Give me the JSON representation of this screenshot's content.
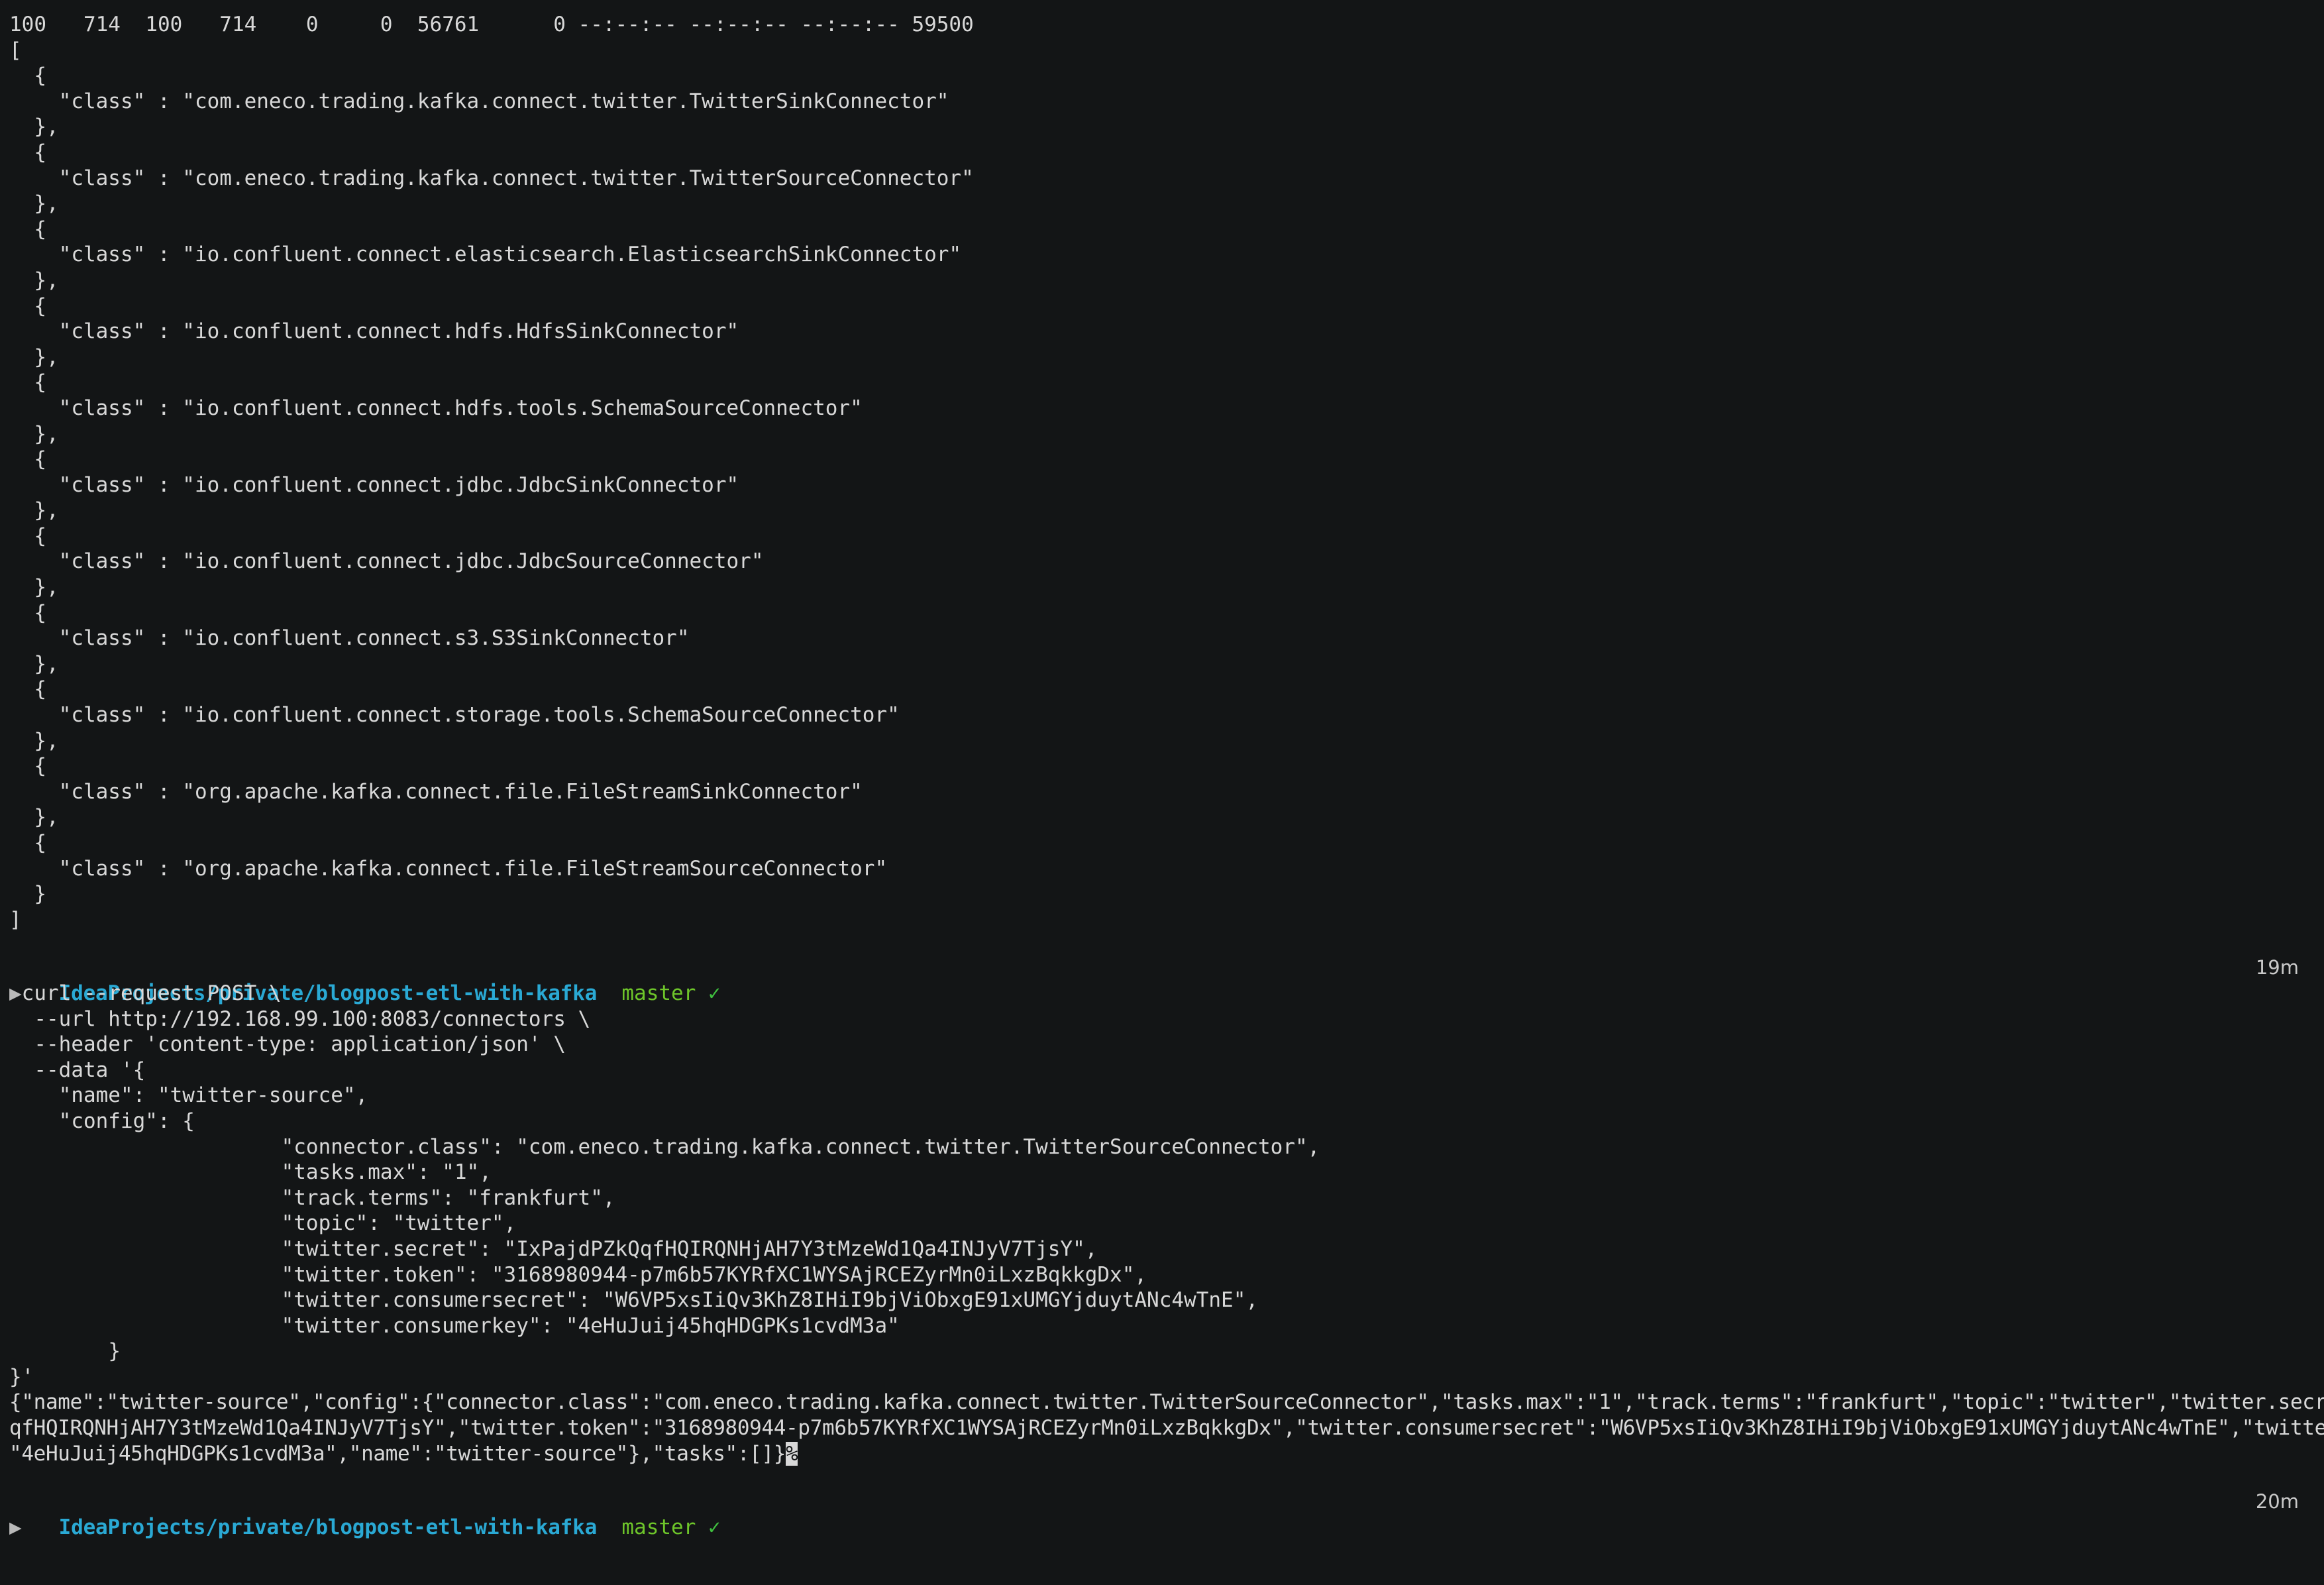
{
  "terminal": {
    "background_color": "#131516",
    "foreground_color": "#d8d8d8",
    "path_color": "#2aa9d4",
    "branch_color": "#6ec62a"
  },
  "curl_progress_line": "100   714  100   714    0     0  56761      0 --:--:-- --:--:-- --:--:-- 59500",
  "connectors_response": {
    "open_bracket": "[",
    "close_bracket": "]",
    "entries": [
      {
        "open": "{",
        "key": "\"class\"",
        "sep": " : ",
        "value": "\"com.eneco.trading.kafka.connect.twitter.TwitterSinkConnector\"",
        "close": "},"
      },
      {
        "open": "{",
        "key": "\"class\"",
        "sep": " : ",
        "value": "\"com.eneco.trading.kafka.connect.twitter.TwitterSourceConnector\"",
        "close": "},"
      },
      {
        "open": "{",
        "key": "\"class\"",
        "sep": " : ",
        "value": "\"io.confluent.connect.elasticsearch.ElasticsearchSinkConnector\"",
        "close": "},"
      },
      {
        "open": "{",
        "key": "\"class\"",
        "sep": " : ",
        "value": "\"io.confluent.connect.hdfs.HdfsSinkConnector\"",
        "close": "},"
      },
      {
        "open": "{",
        "key": "\"class\"",
        "sep": " : ",
        "value": "\"io.confluent.connect.hdfs.tools.SchemaSourceConnector\"",
        "close": "},"
      },
      {
        "open": "{",
        "key": "\"class\"",
        "sep": " : ",
        "value": "\"io.confluent.connect.jdbc.JdbcSinkConnector\"",
        "close": "},"
      },
      {
        "open": "{",
        "key": "\"class\"",
        "sep": " : ",
        "value": "\"io.confluent.connect.jdbc.JdbcSourceConnector\"",
        "close": "},"
      },
      {
        "open": "{",
        "key": "\"class\"",
        "sep": " : ",
        "value": "\"io.confluent.connect.s3.S3SinkConnector\"",
        "close": "},"
      },
      {
        "open": "{",
        "key": "\"class\"",
        "sep": " : ",
        "value": "\"io.confluent.connect.storage.tools.SchemaSourceConnector\"",
        "close": "},"
      },
      {
        "open": "{",
        "key": "\"class\"",
        "sep": " : ",
        "value": "\"org.apache.kafka.connect.file.FileStreamSinkConnector\"",
        "close": "},"
      },
      {
        "open": "{",
        "key": "\"class\"",
        "sep": " : ",
        "value": "\"org.apache.kafka.connect.file.FileStreamSourceConnector\"",
        "close": "}"
      }
    ]
  },
  "prompt_1": {
    "path": "IdeaProjects/private/blogpost-etl-with-kafka",
    "branch": "master",
    "status_glyph": "✓",
    "elapsed": "19m",
    "arrow": "▶"
  },
  "command": {
    "line_1": "curl --request POST \\",
    "line_2": "--url http://192.168.99.100:8083/connectors \\",
    "line_3": "--header 'content-type: application/json' \\",
    "line_4": "--data '{",
    "line_5": "\"name\": \"twitter-source\",",
    "line_6": "\"config\": {",
    "config_lines": [
      "\"connector.class\": \"com.eneco.trading.kafka.connect.twitter.TwitterSourceConnector\",",
      "\"tasks.max\": \"1\",",
      "\"track.terms\": \"frankfurt\",",
      "\"topic\": \"twitter\",",
      "\"twitter.secret\": \"IxPajdPZkQqfHQIRQNHjAH7Y3tMzeWd1Qa4INJyV7TjsY\",",
      "\"twitter.token\": \"3168980944-p7m6b57KYRfXC1WYSAjRCEZyrMn0iLxzBqkkgDx\",",
      "\"twitter.consumersecret\": \"W6VP5xsIiQv3KhZ8IHiI9bjViObxgE91xUMGYjduytANc4wTnE\",",
      "\"twitter.consumerkey\": \"4eHuJuij45hqHDGPKs1cvdM3a\""
    ],
    "close_config": "}",
    "close_data": "}'"
  },
  "response_output": {
    "wrapped_line_1": "{\"name\":\"twitter-source\",\"config\":{\"connector.class\":\"com.eneco.trading.kafka.connect.twitter.TwitterSourceConnector\",\"tasks.max\":\"1\",\"track.terms\":\"frankfurt\",\"topic\":\"twitter\",\"twitter.secret\":\"IxPajdPZkQ",
    "wrapped_line_2": "qfHQIRQNHjAH7Y3tMzeWd1Qa4INJyV7TjsY\",\"twitter.token\":\"3168980944-p7m6b57KYRfXC1WYSAjRCEZyrMn0iLxzBqkkgDx\",\"twitter.consumersecret\":\"W6VP5xsIiQv3KhZ8IHiI9bjViObxgE91xUMGYjduytANc4wTnE\",\"twitter.consumerkey\":",
    "wrapped_line_3": "\"4eHuJuij45hqHDGPKs1cvdM3a\",\"name\":\"twitter-source\"},\"tasks\":[]}",
    "no_newline_marker": "%"
  },
  "prompt_2": {
    "path": "IdeaProjects/private/blogpost-etl-with-kafka",
    "branch": "master",
    "status_glyph": "✓",
    "elapsed": "20m",
    "arrow": "▶"
  }
}
